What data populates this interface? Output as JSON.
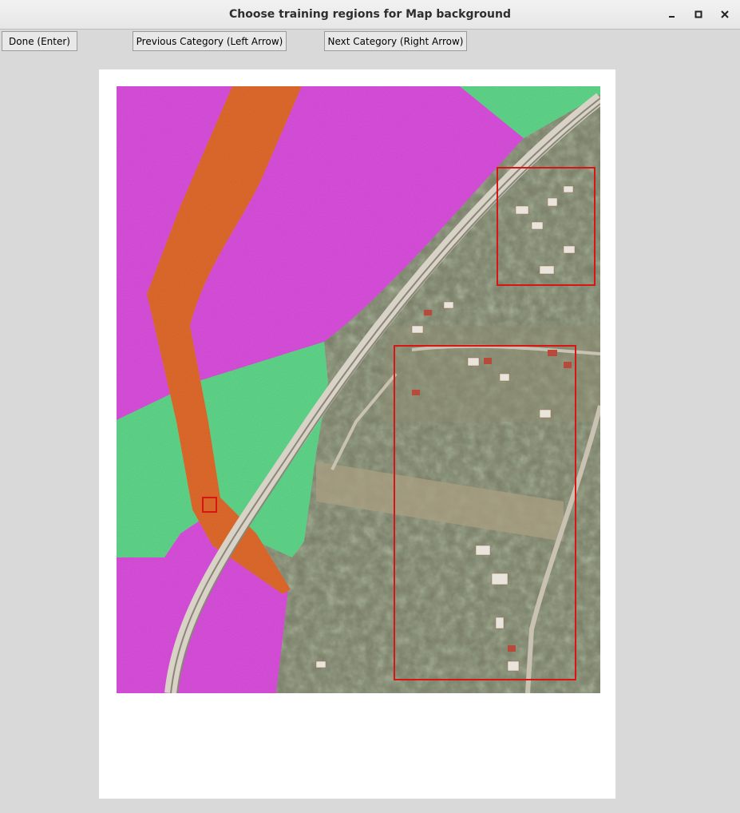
{
  "window": {
    "title": "Choose training regions for Map background",
    "controls": {
      "minimize": "–",
      "maximize": "□",
      "close": "✕"
    }
  },
  "toolbar": {
    "done_label": "Done (Enter)",
    "prev_label": "Previous Category (Left Arrow)",
    "next_label": "Next Category (Right Arrow)"
  },
  "map": {
    "category_colors": {
      "magenta": "#d94fdc",
      "orange": "#e06a2c",
      "green": "#5fd68a",
      "selection": "#d81414"
    }
  }
}
